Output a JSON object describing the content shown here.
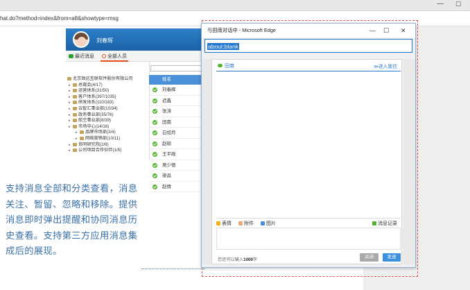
{
  "browser": {
    "url": "hat.do?method=index&from=a8&showtype=msg",
    "minimize_glyph": "—",
    "maximize_glyph": "☐"
  },
  "app": {
    "user_name": "刘春辉",
    "tabs": [
      "最近消息",
      "全部人员"
    ],
    "tree": [
      {
        "label": "北京致远互联软件股份有限公司",
        "level": 0
      },
      {
        "label": "总裁会(4/17)",
        "level": 1
      },
      {
        "label": "运营体系(31/50)",
        "level": 1
      },
      {
        "label": "客户体系(397/1035)",
        "level": 1
      },
      {
        "label": "研发体系(110/183)",
        "level": 1
      },
      {
        "label": "云智汇事业部(10/34)",
        "level": 1
      },
      {
        "label": "政务事业部(35/76)",
        "level": 1
      },
      {
        "label": "航空事业部(8/39)",
        "level": 1
      },
      {
        "label": "市场中心(14/16)",
        "level": 1
      },
      {
        "label": "品牌市场部(3/4)",
        "level": 2
      },
      {
        "label": "网络营销部(10/11)",
        "level": 2
      },
      {
        "label": "协同研究院(2/8)",
        "level": 1
      },
      {
        "label": "公司项目合作伙伴(1/5)",
        "level": 1
      }
    ],
    "people_header": "姓名",
    "people": [
      "刘春辉",
      "迟鑫",
      "张涛",
      "田南",
      "白如月",
      "赵硕",
      "王平政",
      "吴少德",
      "梁昌",
      "赵倩"
    ]
  },
  "description": [
    "支持消息全部和分类查看，消息",
    "关注、暂留、忽略和移除。提供",
    "消息即时弹出提醒和协同消息历",
    "史查看。支持第三方应用消息集",
    "成后的展现。"
  ],
  "popup": {
    "title": "与田南对话中 - Microsoft Edge",
    "controls": [
      "—",
      "☐",
      "✕"
    ],
    "address": "about:blank",
    "chat_tab": "田南",
    "enter_more": "≫进入致信",
    "toolbar": {
      "emoji": "表情",
      "attach": "附件",
      "image": "图片",
      "history": "消息记录"
    },
    "input_tip_prefix": "您还可以输入",
    "input_tip_count": "1000",
    "input_tip_suffix": "字",
    "close_label": "关闭",
    "send_label": "发送"
  },
  "colors": {
    "accent": "#2b79c2",
    "header_blue": "#1b63a8",
    "online_green": "#52b52c",
    "description": "#3b72a8",
    "dashed_border": "#d9534f"
  }
}
